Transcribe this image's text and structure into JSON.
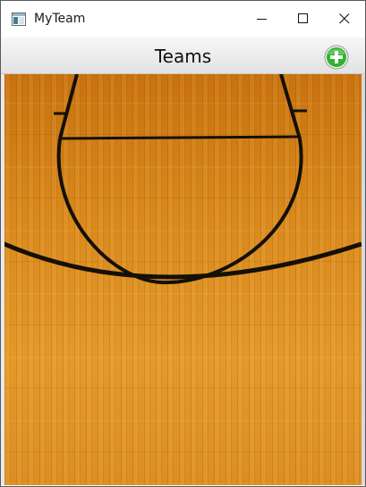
{
  "window": {
    "title": "MyTeam",
    "app_icon": "app-window-icon",
    "controls": {
      "minimize_icon": "minimize-icon",
      "maximize_icon": "maximize-icon",
      "close_icon": "close-icon"
    }
  },
  "toolbar": {
    "title": "Teams",
    "add_icon": "plus-circle-icon",
    "add_color": "#2db32d"
  },
  "background": {
    "name": "basketball-court-floor",
    "wood_color": "#d9891c",
    "line_color": "#111111"
  }
}
